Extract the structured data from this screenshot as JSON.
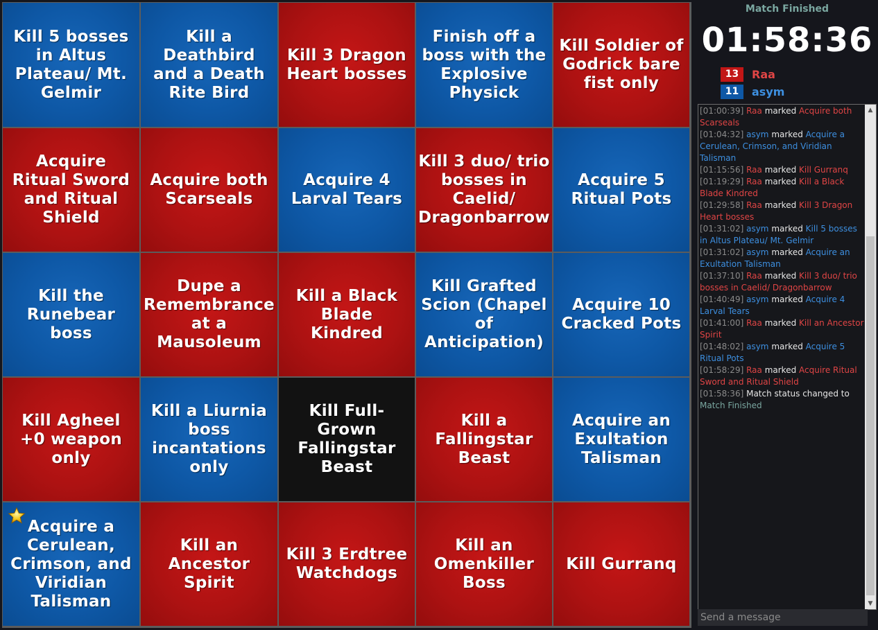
{
  "colors": {
    "red": "#b01313",
    "blue": "#0e58a6",
    "black": "#121212",
    "accent": "#7aa7a0"
  },
  "board": {
    "cells": [
      {
        "text": "Kill 5 bosses in Altus Plateau/ Mt. Gelmir",
        "color": "blue"
      },
      {
        "text": "Kill a Deathbird and a Death Rite Bird",
        "color": "blue"
      },
      {
        "text": "Kill 3 Dragon Heart bosses",
        "color": "red"
      },
      {
        "text": "Finish off a boss with the Explosive Physick",
        "color": "blue"
      },
      {
        "text": "Kill Soldier of Godrick bare fist only",
        "color": "red"
      },
      {
        "text": "Acquire Ritual Sword and Ritual Shield",
        "color": "red"
      },
      {
        "text": "Acquire both Scarseals",
        "color": "red"
      },
      {
        "text": "Acquire 4 Larval Tears",
        "color": "blue"
      },
      {
        "text": "Kill 3 duo/ trio bosses in Caelid/ Dragonbarrow",
        "color": "red"
      },
      {
        "text": "Acquire 5 Ritual Pots",
        "color": "blue"
      },
      {
        "text": "Kill the Runebear boss",
        "color": "blue"
      },
      {
        "text": "Dupe a Remembrance at a Mausoleum",
        "color": "red"
      },
      {
        "text": "Kill a Black Blade Kindred",
        "color": "red"
      },
      {
        "text": "Kill Grafted Scion (Chapel of Anticipation)",
        "color": "blue"
      },
      {
        "text": "Acquire 10 Cracked Pots",
        "color": "blue"
      },
      {
        "text": "Kill Agheel +0 weapon only",
        "color": "red"
      },
      {
        "text": "Kill a Liurnia boss incantations only",
        "color": "blue"
      },
      {
        "text": "Kill Full-Grown Fallingstar Beast",
        "color": "black"
      },
      {
        "text": "Kill a Fallingstar Beast",
        "color": "red"
      },
      {
        "text": "Acquire an Exultation Talisman",
        "color": "blue"
      },
      {
        "text": "Acquire a Cerulean, Crimson, and Viridian Talisman",
        "color": "blue",
        "star": true
      },
      {
        "text": "Kill an Ancestor Spirit",
        "color": "red"
      },
      {
        "text": "Kill 3 Erdtree Watchdogs",
        "color": "red"
      },
      {
        "text": "Kill an Omenkiller Boss",
        "color": "red"
      },
      {
        "text": "Kill Gurranq",
        "color": "red"
      }
    ]
  },
  "sidebar": {
    "status": "Match Finished",
    "timer": "01:58:36",
    "players": [
      {
        "name": "Raa",
        "score": "13",
        "color": "#e04545",
        "bg": "#c21616"
      },
      {
        "name": "asym",
        "score": "11",
        "color": "#3d8fe0",
        "bg": "#0e58a6"
      }
    ]
  },
  "chat": {
    "log": [
      {
        "time": "[01:00:39]",
        "player": "Raa",
        "team": "red",
        "action": "marked",
        "goal": "Acquire both Scarseals"
      },
      {
        "time": "[01:04:32]",
        "player": "asym",
        "team": "blue",
        "action": "marked",
        "goal": "Acquire a Cerulean, Crimson, and Viridian Talisman"
      },
      {
        "time": "[01:15:56]",
        "player": "Raa",
        "team": "red",
        "action": "marked",
        "goal": "Kill Gurranq"
      },
      {
        "time": "[01:19:29]",
        "player": "Raa",
        "team": "red",
        "action": "marked",
        "goal": "Kill a Black Blade Kindred"
      },
      {
        "time": "[01:29:58]",
        "player": "Raa",
        "team": "red",
        "action": "marked",
        "goal": "Kill 3 Dragon Heart bosses"
      },
      {
        "time": "[01:31:02]",
        "player": "asym",
        "team": "blue",
        "action": "marked",
        "goal": "Kill 5 bosses in Altus Plateau/ Mt. Gelmir"
      },
      {
        "time": "[01:31:02]",
        "player": "asym",
        "team": "blue",
        "action": "marked",
        "goal": "Acquire an Exultation Talisman"
      },
      {
        "time": "[01:37:10]",
        "player": "Raa",
        "team": "red",
        "action": "marked",
        "goal": "Kill 3 duo/ trio bosses in Caelid/ Dragonbarrow"
      },
      {
        "time": "[01:40:49]",
        "player": "asym",
        "team": "blue",
        "action": "marked",
        "goal": "Acquire 4 Larval Tears"
      },
      {
        "time": "[01:41:00]",
        "player": "Raa",
        "team": "red",
        "action": "marked",
        "goal": "Kill an Ancestor Spirit"
      },
      {
        "time": "[01:48:02]",
        "player": "asym",
        "team": "blue",
        "action": "marked",
        "goal": "Acquire 5 Ritual Pots"
      },
      {
        "time": "[01:58:29]",
        "player": "Raa",
        "team": "red",
        "action": "marked",
        "goal": "Acquire Ritual Sword and Ritual Shield"
      }
    ],
    "final": {
      "time": "[01:58:36]",
      "text": "Match status changed to",
      "status": "Match Finished"
    },
    "input_placeholder": "Send a message"
  }
}
